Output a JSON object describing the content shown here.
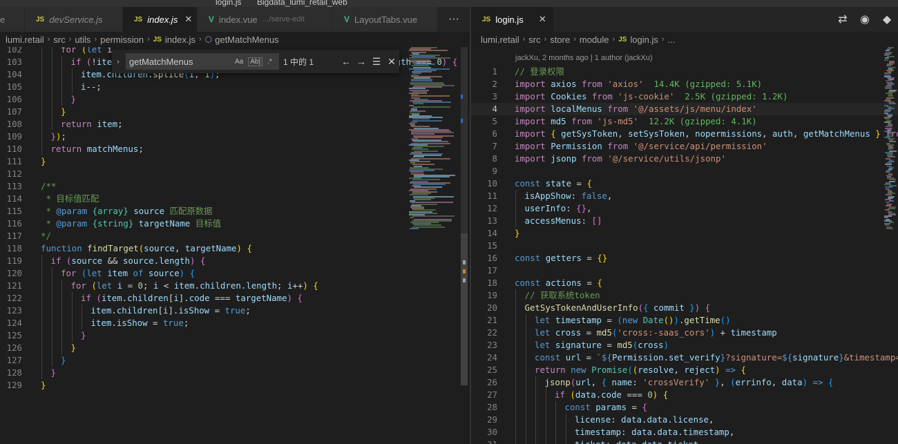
{
  "window": {
    "title_left": "login.js",
    "title_right": "Bigdata_lumi_retail_web"
  },
  "left": {
    "tabs": [
      {
        "icon": "",
        "label": "e",
        "desc": "",
        "active": false
      },
      {
        "icon": "JS",
        "label": "devService.js",
        "desc": "",
        "active": false
      },
      {
        "icon": "JS",
        "label": "index.js",
        "desc": "",
        "active": true
      },
      {
        "icon": "V",
        "label": "index.vue",
        "desc": "…/serve-edit",
        "active": false
      },
      {
        "icon": "V",
        "label": "LayoutTabs.vue",
        "desc": "",
        "active": false
      }
    ],
    "more_label": "···",
    "breadcrumb": [
      "lumi.retail",
      "src",
      "utils",
      "permission",
      "index.js",
      "getMatchMenus"
    ],
    "find": {
      "query": "getMatchMenus",
      "match_case": "Aa",
      "whole_word": "Ab|",
      "regex": ".*",
      "count": "1 中的 1",
      "prev": "←",
      "next": "→",
      "selection": "☰",
      "close": "✕"
    },
    "lines": [
      {
        "n": "102",
        "indent": 2,
        "html": "<span class='kc'>for</span> <span class='y'>(</span><span class='k'>let</span> i"
      },
      {
        "n": "103",
        "indent": 3,
        "html": "<span class='kc'>if</span> <span class='pk'>(</span>!<span class='v'>item</span>.<span class='v'>children</span>[<span class='v'>i</span>].<span class='v'>children</span> || <span class='v'>item</span>.<span class='v'>children</span>[<span class='v'>i</span>].<span class='v'>children</span>.<span class='v'>length</span> === <span class='n'>0</span><span class='pk'>)</span> <span class='pk'>{</span>"
      },
      {
        "n": "104",
        "indent": 4,
        "html": "<span class='v'>item</span>.<span class='v'>children</span>.<span class='f'>splice</span><span class='b'>(</span><span class='v'>i</span>, <span class='n'>1</span><span class='b'>)</span>;"
      },
      {
        "n": "105",
        "indent": 4,
        "html": "<span class='v'>i</span>--;"
      },
      {
        "n": "106",
        "indent": 3,
        "html": "<span class='pk'>}</span>"
      },
      {
        "n": "107",
        "indent": 2,
        "html": "<span class='y'>}</span>"
      },
      {
        "n": "108",
        "indent": 2,
        "html": "<span class='kc'>return</span> <span class='v'>item</span>;"
      },
      {
        "n": "109",
        "indent": 1,
        "html": "<span class='pk'>}</span><span class='y'>)</span>;"
      },
      {
        "n": "110",
        "indent": 1,
        "html": "<span class='kc'>return</span> <span class='v'>matchMenus</span>;"
      },
      {
        "n": "111",
        "indent": 0,
        "html": "<span class='y'>}</span>"
      },
      {
        "n": "112",
        "indent": 0,
        "html": ""
      },
      {
        "n": "113",
        "indent": 0,
        "html": "<span class='c'>/**</span>"
      },
      {
        "n": "114",
        "indent": 0,
        "html": "<span class='c'> * 目标值匹配</span>"
      },
      {
        "n": "115",
        "indent": 0,
        "html": "<span class='c'> * </span><span class='k'>@param</span> <span class='t'>{array}</span> <span class='v'>source</span> <span class='c'>匹配原数据</span>"
      },
      {
        "n": "116",
        "indent": 0,
        "html": "<span class='c'> * </span><span class='k'>@param</span> <span class='t'>{string}</span> <span class='v'>targetName</span> <span class='c'>目标值</span>"
      },
      {
        "n": "117",
        "indent": 0,
        "html": "<span class='c'>*/</span>"
      },
      {
        "n": "118",
        "indent": 0,
        "html": "<span class='k'>function</span> <span class='f'>findTarget</span><span class='y'>(</span><span class='v'>source</span>, <span class='v'>targetName</span><span class='y'>)</span> <span class='y'>{</span>"
      },
      {
        "n": "119",
        "indent": 1,
        "html": "<span class='kc'>if</span> <span class='pk'>(</span><span class='v'>source</span> &amp;&amp; <span class='v'>source</span>.<span class='v'>length</span><span class='pk'>)</span> <span class='pk'>{</span>"
      },
      {
        "n": "120",
        "indent": 2,
        "html": "<span class='kc'>for</span> <span class='b'>(</span><span class='k'>let</span> <span class='v'>item</span> <span class='k'>of</span> <span class='v'>source</span><span class='b'>)</span> <span class='b'>{</span>"
      },
      {
        "n": "121",
        "indent": 3,
        "html": "<span class='kc'>for</span> <span class='y'>(</span><span class='k'>let</span> <span class='v'>i</span> = <span class='n'>0</span>; <span class='v'>i</span> &lt; <span class='v'>item</span>.<span class='v'>children</span>.<span class='v'>length</span>; <span class='v'>i</span>++<span class='y'>)</span> <span class='y'>{</span>"
      },
      {
        "n": "122",
        "indent": 4,
        "html": "<span class='kc'>if</span> <span class='pk'>(</span><span class='v'>item</span>.<span class='v'>children</span>[<span class='v'>i</span>].<span class='v'>code</span> === <span class='v'>targetName</span><span class='pk'>)</span> <span class='pk'>{</span>"
      },
      {
        "n": "123",
        "indent": 5,
        "html": "<span class='v'>item</span>.<span class='v'>children</span>[<span class='v'>i</span>].<span class='v'>isShow</span> = <span class='k'>true</span>;"
      },
      {
        "n": "124",
        "indent": 5,
        "html": "<span class='v'>item</span>.<span class='v'>isShow</span> = <span class='k'>true</span>;"
      },
      {
        "n": "125",
        "indent": 4,
        "html": "<span class='pk'>}</span>"
      },
      {
        "n": "126",
        "indent": 3,
        "html": "<span class='y'>}</span>"
      },
      {
        "n": "127",
        "indent": 2,
        "html": "<span class='b'>}</span>"
      },
      {
        "n": "128",
        "indent": 1,
        "html": "<span class='pk'>}</span>"
      },
      {
        "n": "129",
        "indent": 0,
        "html": "<span class='y'>}</span>"
      }
    ]
  },
  "right": {
    "tab": {
      "icon": "JS",
      "label": "login.js",
      "close": "✕"
    },
    "actions": [
      "⇄",
      "◉",
      "◆"
    ],
    "breadcrumb": [
      "lumi.retail",
      "src",
      "store",
      "module",
      "login.js",
      "..."
    ],
    "codelens": "jackXu, 2 months ago | 1 author (jackXu)",
    "current_line": "4",
    "lines": [
      {
        "n": "1",
        "indent": 0,
        "html": "<span class='c'>// 登录权限</span>"
      },
      {
        "n": "2",
        "indent": 0,
        "html": "<span class='kc'>import</span> <span class='v'>axios</span> <span class='kc'>from</span> <span class='s'>'axios'</span>  <span class='sz'>14.4K (gzipped: 5.1K)</span>"
      },
      {
        "n": "3",
        "indent": 0,
        "html": "<span class='kc'>import</span> <span class='v'>Cookies</span> <span class='kc'>from</span> <span class='s'>'js-cookie'</span>  <span class='sz'>2.5K (gzipped: 1.2K)</span>"
      },
      {
        "n": "4",
        "indent": 0,
        "html": "<span class='kc'>import</span> <span class='v'>localMenus</span> <span class='kc'>from</span> <span class='s'>'@/assets/js/menu/index'</span>"
      },
      {
        "n": "5",
        "indent": 0,
        "html": "<span class='kc'>import</span> <span class='v'>md5</span> <span class='kc'>from</span> <span class='s'>'js-md5'</span>  <span class='sz'>12.2K (gzipped: 4.1K)</span>"
      },
      {
        "n": "6",
        "indent": 0,
        "html": "<span class='kc'>import</span> <span class='y'>{</span> <span class='v'>getSysToken</span>, <span class='v'>setSysToken</span>, <span class='v'>nopermissions</span>, <span class='v'>auth</span>, <span class='v'>getMatchMenus</span> <span class='y'>}</span> <span class='kc'>from</span> <span class='s'>'@/utils/permission'</span>"
      },
      {
        "n": "7",
        "indent": 0,
        "html": "<span class='kc'>import</span> <span class='v'>Permission</span> <span class='kc'>from</span> <span class='s'>'@/service/api/permission'</span>"
      },
      {
        "n": "8",
        "indent": 0,
        "html": "<span class='kc'>import</span> <span class='v'>jsonp</span> <span class='kc'>from</span> <span class='s'>'@/service/utils/jsonp'</span>"
      },
      {
        "n": "9",
        "indent": 0,
        "html": ""
      },
      {
        "n": "10",
        "indent": 0,
        "html": "<span class='k'>const</span> <span class='v'>state</span> = <span class='y'>{</span>"
      },
      {
        "n": "11",
        "indent": 1,
        "html": "<span class='v'>isAppShow</span>: <span class='k'>false</span>,"
      },
      {
        "n": "12",
        "indent": 1,
        "html": "<span class='v'>userInfo</span>: <span class='pk'>{}</span>,"
      },
      {
        "n": "13",
        "indent": 1,
        "html": "<span class='v'>accessMenus</span>: <span class='pk'>[]</span>"
      },
      {
        "n": "14",
        "indent": 0,
        "html": "<span class='y'>}</span>"
      },
      {
        "n": "15",
        "indent": 0,
        "html": ""
      },
      {
        "n": "16",
        "indent": 0,
        "html": "<span class='k'>const</span> <span class='v'>getters</span> = <span class='y'>{}</span>"
      },
      {
        "n": "17",
        "indent": 0,
        "html": ""
      },
      {
        "n": "18",
        "indent": 0,
        "html": "<span class='k'>const</span> <span class='v'>actions</span> = <span class='y'>{</span>"
      },
      {
        "n": "19",
        "indent": 1,
        "html": "<span class='c'>// 获取系统token</span>"
      },
      {
        "n": "20",
        "indent": 1,
        "html": "<span class='f'>GetSysTokenAndUserInfo</span><span class='pk'>(</span><span class='b'>{</span> <span class='v'>commit</span> <span class='b'>}</span><span class='pk'>)</span> <span class='pk'>{</span>"
      },
      {
        "n": "21",
        "indent": 2,
        "html": "<span class='k'>let</span> <span class='v'>timestamp</span> = <span class='b'>(</span><span class='k'>new</span> <span class='t'>Date</span><span class='y'>()</span><span class='b'>)</span>.<span class='f'>getTime</span><span class='b'>()</span>"
      },
      {
        "n": "22",
        "indent": 2,
        "html": "<span class='k'>let</span> <span class='v'>cross</span> = <span class='f'>md5</span><span class='b'>(</span><span class='s'>'cross:-saas_cors'</span><span class='b'>)</span> + <span class='v'>timestamp</span>"
      },
      {
        "n": "23",
        "indent": 2,
        "html": "<span class='k'>let</span> <span class='v'>signature</span> = <span class='f'>md5</span><span class='b'>(</span><span class='v'>cross</span><span class='b'>)</span>"
      },
      {
        "n": "24",
        "indent": 2,
        "html": "<span class='k'>const</span> <span class='v'>url</span> = <span class='s'>`</span><span class='k'>${</span><span class='v'>Permission</span>.<span class='v'>set_verify</span><span class='k'>}</span><span class='s'>?signature=</span><span class='k'>${</span><span class='v'>signature</span><span class='k'>}</span><span class='s'>&amp;timestamp=</span><span class='k'>${</span><span class='v'>timestamp</span><span class='k'>}</span><span class='s'>`</span>"
      },
      {
        "n": "25",
        "indent": 2,
        "html": "<span class='kc'>return</span> <span class='k'>new</span> <span class='t'>Promise</span><span class='b'>(</span><span class='y'>(</span><span class='v'>resolve</span>, <span class='v'>reject</span><span class='y'>)</span> <span class='k'>=&gt;</span> <span class='y'>{</span>"
      },
      {
        "n": "26",
        "indent": 3,
        "html": "<span class='f'>jsonp</span><span class='pk'>(</span><span class='v'>url</span>, <span class='b'>{</span> <span class='v'>name</span>: <span class='s'>'crossVerify'</span> <span class='b'>}</span>, <span class='b'>(</span><span class='v'>errinfo</span>, <span class='v'>data</span><span class='b'>)</span> <span class='k'>=&gt;</span> <span class='b'>{</span>"
      },
      {
        "n": "27",
        "indent": 4,
        "html": "<span class='kc'>if</span> <span class='y'>(</span><span class='v'>data</span>.<span class='v'>code</span> === <span class='n'>0</span><span class='y'>)</span> <span class='y'>{</span>"
      },
      {
        "n": "28",
        "indent": 5,
        "html": "<span class='k'>const</span> <span class='v'>params</span> = <span class='pk'>{</span>"
      },
      {
        "n": "29",
        "indent": 6,
        "html": "<span class='v'>license</span>: <span class='v'>data</span>.<span class='v'>data</span>.<span class='v'>license</span>,"
      },
      {
        "n": "30",
        "indent": 6,
        "html": "<span class='v'>timestamp</span>: <span class='v'>data</span>.<span class='v'>data</span>.<span class='v'>timestamp</span>,"
      },
      {
        "n": "31",
        "indent": 6,
        "html": "<span class='v'>ticket</span>: <span class='v'>data</span>.<span class='v'>data</span>.<span class='v'>ticket</span>"
      }
    ]
  }
}
